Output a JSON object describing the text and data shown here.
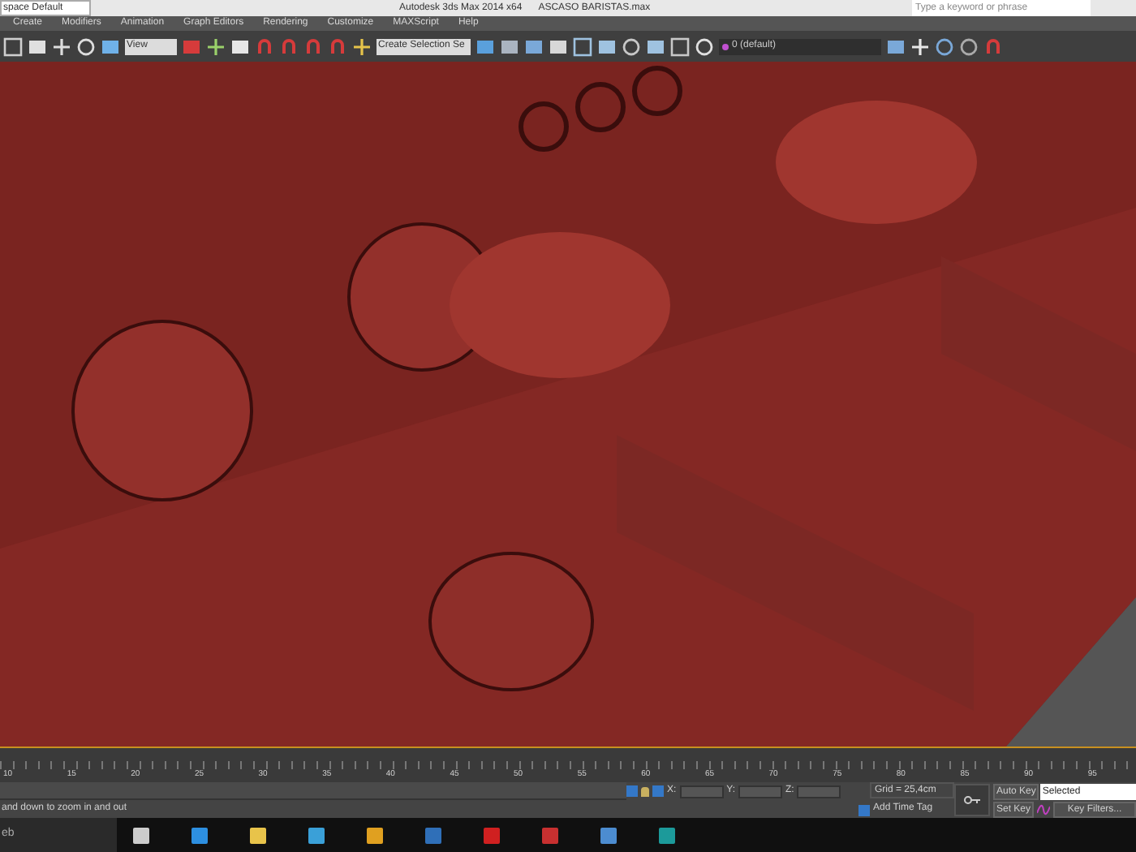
{
  "title_bar": {
    "workspace": "space Default",
    "title": "Autodesk 3ds Max 2014 x64",
    "file": "ASCASO BARISTAS.max",
    "search": {
      "placeholder": "Type a keyword or phrase"
    }
  },
  "menu": [
    "Create",
    "Modifiers",
    "Animation",
    "Graph Editors",
    "Rendering",
    "Customize",
    "MAXScript",
    "Help"
  ],
  "toolbar": {
    "reference_dropdown": "View",
    "selection_set_dropdown": "Create Selection Se",
    "layer_dropdown": "0 (default)"
  },
  "timeline": {
    "ticks": [
      "10",
      "15",
      "20",
      "25",
      "30",
      "35",
      "40",
      "45",
      "50",
      "55",
      "60",
      "65",
      "70",
      "75",
      "80",
      "85",
      "90",
      "95"
    ]
  },
  "status": {
    "prompt": "and down to zoom in and out",
    "x_label": "X:",
    "y_label": "Y:",
    "z_label": "Z:",
    "grid": "Grid = 25,4cm",
    "add_time_tag": "Add Time Tag",
    "auto_key": "Auto Key",
    "key_mode": "Selected",
    "set_key": "Set Key",
    "key_filters": "Key Filters..."
  },
  "taskbar": {
    "search": "eb"
  }
}
